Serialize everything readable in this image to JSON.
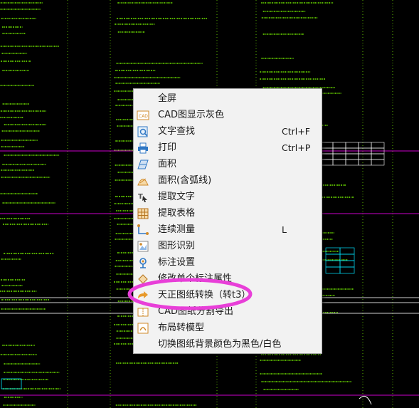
{
  "context_menu": {
    "items": [
      {
        "label": "全屏",
        "shortcut": "",
        "icon": "none"
      },
      {
        "label": "CAD图显示灰色",
        "shortcut": "",
        "icon": "gray-display-icon"
      },
      {
        "label": "文字查找",
        "shortcut": "Ctrl+F",
        "icon": "text-search-icon"
      },
      {
        "label": "打印",
        "shortcut": "Ctrl+P",
        "icon": "printer-icon"
      },
      {
        "label": "面积",
        "shortcut": "",
        "icon": "area-icon"
      },
      {
        "label": "面积(含弧线)",
        "shortcut": "",
        "icon": "arc-area-icon"
      },
      {
        "label": "提取文字",
        "shortcut": "",
        "icon": "extract-text-icon"
      },
      {
        "label": "提取表格",
        "shortcut": "",
        "icon": "extract-table-icon"
      },
      {
        "label": "连续测量",
        "shortcut": "L",
        "icon": "measure-icon"
      },
      {
        "label": "图形识别",
        "shortcut": "",
        "icon": "shape-recognize-icon"
      },
      {
        "label": "标注设置",
        "shortcut": "",
        "icon": "annotation-settings-icon"
      },
      {
        "label": "修改单个标注属性",
        "shortcut": "",
        "icon": "edit-annotation-icon"
      },
      {
        "label": "天正图纸转换（转t3）",
        "shortcut": "",
        "icon": "convert-icon"
      },
      {
        "label": "CAD图纸分割导出",
        "shortcut": "",
        "icon": "split-export-icon"
      },
      {
        "label": "布局转模型",
        "shortcut": "",
        "icon": "layout-to-model-icon"
      },
      {
        "label": "切换图纸背景颜色为黑色/白色",
        "shortcut": "",
        "icon": "none"
      }
    ]
  },
  "colors": {
    "cad_background": "#000000",
    "cad_text": "#7CFC00",
    "cad_lines": "#ff00ff",
    "highlight_ring": "#e83fd8",
    "menu_background": "#f2f2f2"
  }
}
